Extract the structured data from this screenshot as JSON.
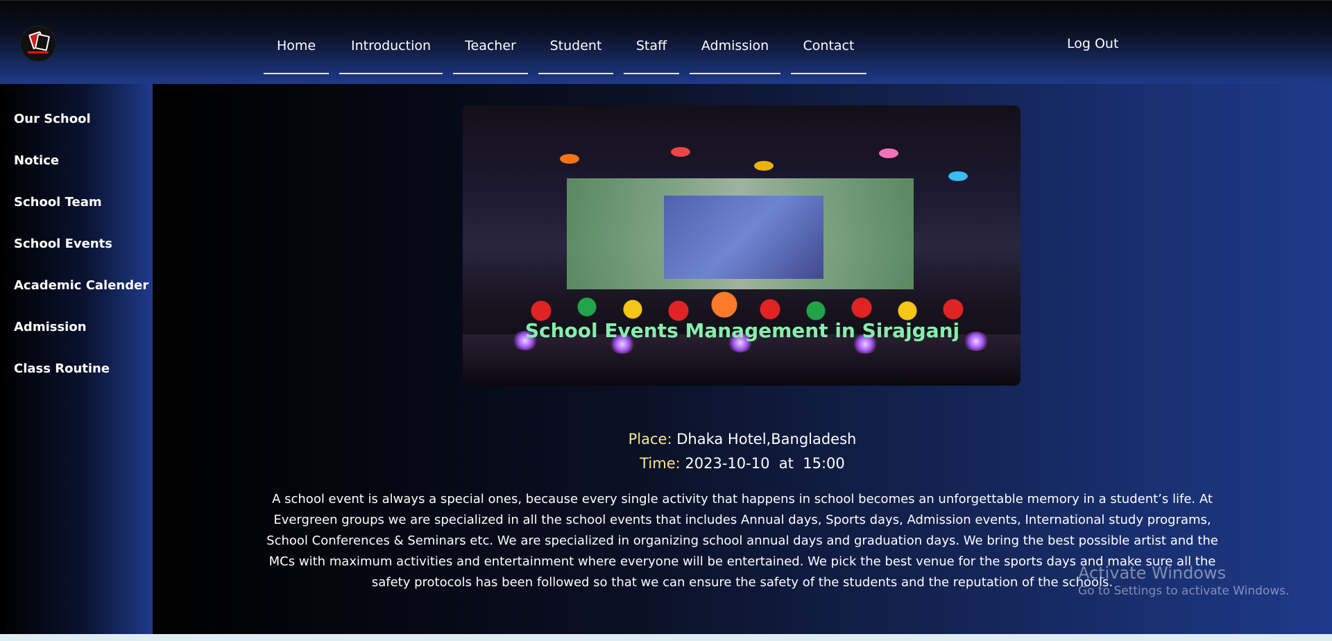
{
  "header": {
    "logo": "school-logo",
    "nav": [
      "Home",
      "Introduction",
      "Teacher",
      "Student",
      "Staff",
      "Admission",
      "Contact"
    ],
    "logout_label": "Log Out"
  },
  "sidebar": {
    "items": [
      "Our School",
      "Notice",
      "School Team",
      "School Events",
      "Academic Calender",
      "Admission",
      "Class Routine"
    ]
  },
  "event": {
    "image": "school-annual-day-stage-photo",
    "title": "School Events Management in Sirajganj",
    "place_label": "Place:",
    "place_value": "Dhaka Hotel,Bangladesh",
    "time_label": "Time:",
    "time_value": "2023-10-10  at  15:00",
    "description": "A school event is always a special ones, because every single activity that happens in school becomes an unforgettable memory in a student’s life. At Evergreen groups we are specialized in all the school events that includes Annual days, Sports days, Admission events, International study programs, School Conferences & Seminars etc. We are specialized in organizing school annual days and graduation days. We bring the best possible artist and the MCs with maximum activities and entertainment where everyone will be entertained. We pick the best venue for the sports days and make sure all the safety protocols has been followed so that we can ensure the safety of the students and the reputation of the schools."
  },
  "watermark": {
    "title": "Activate Windows",
    "subtitle": "Go to Settings to activate Windows."
  }
}
